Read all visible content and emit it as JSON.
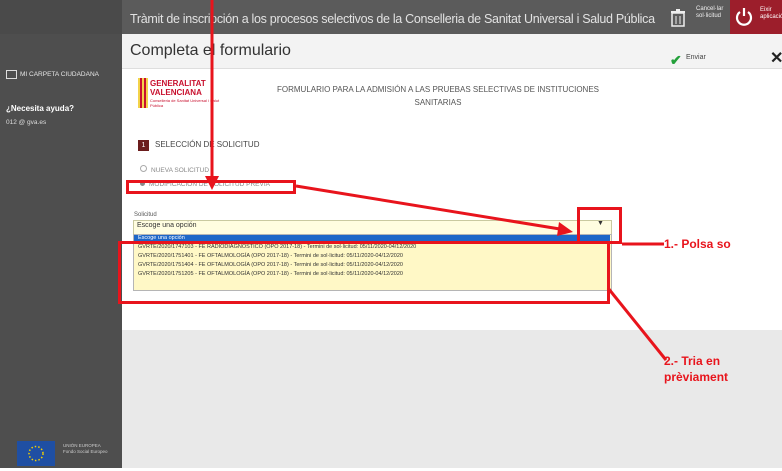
{
  "window": {
    "title": "Tràmit de inscripción a los procesos selectivos de la Conselleria de Sanitat Universal i Salud Pública",
    "cancel_label": "Cancel·lar sol·licitud",
    "exit_label": "Eixir aplicació"
  },
  "sidebar": {
    "carpeta_label": "MI CARPETA CIUDADANA",
    "help_title": "¿Necesita ayuda?",
    "help_row": "012   @   gva.es",
    "eu_text": "UNIÓN EUROPEA Fondo Social Europeo"
  },
  "form_header": {
    "title": "Completa el formulario",
    "submit_label": "Enviar"
  },
  "logo": {
    "name": "GENERALITAT VALENCIANA",
    "sub": "Conselleria de Sanitat Universal i Salut Pública"
  },
  "heading": {
    "text": "FORMULARIO PARA LA ADMISIÓN A LAS PRUEBAS SELECTIVAS DE INSTITUCIONES SANITARIAS"
  },
  "section": {
    "number": "1",
    "title": "SELECCIÓN DE SOLICITUD",
    "option_1": "NUEVA SOLICITUD",
    "option_2": "MODIFICACIÓN DE SOLICITUD PREVIA",
    "field_label": "Solicitud",
    "select_value": "Escoge una opción",
    "select_arrow": "▼",
    "options": [
      "Escoge una opción",
      "GVRTE/2020/1747103 - FE RADIODIAGNÓSTICO (OPO 2017-18) - Termini de sol·licitud: 05/11/2020-04/12/2020",
      "GVRTE/2020/1751401 - FE OFTALMOLOGÍA (OPO 2017-18) - Termini de sol·licitud: 05/11/2020-04/12/2020",
      "GVRTE/2020/1751404 - FE OFTALMOLOGÍA (OPO 2017-18) - Termini de sol·licitud: 05/11/2020-04/12/2020",
      "GVRTE/2020/1751205 - FE OFTALMOLOGÍA (OPO 2017-18) - Termini de sol·licitud: 05/11/2020-04/12/2020"
    ]
  },
  "annotations": {
    "step1": "1.- Polsa so",
    "step2_line1": "2.- Tria en",
    "step2_line2": "prèviament"
  },
  "colors": {
    "annotation_red": "#e8141c",
    "exit_red": "#9c1e2b",
    "selected_blue": "#1e67c8"
  }
}
